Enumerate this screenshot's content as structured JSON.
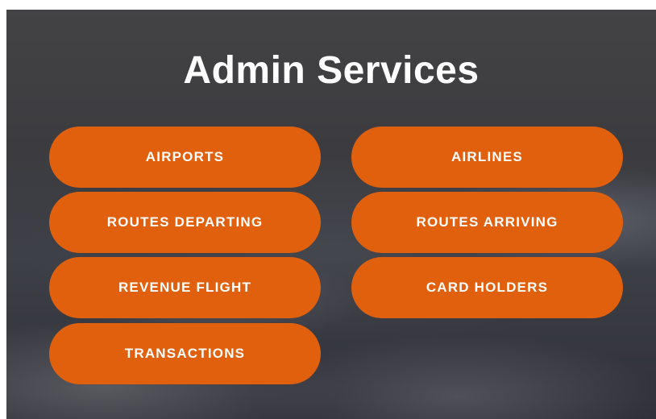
{
  "header": {
    "title": "Admin Services"
  },
  "buttons": {
    "airports": "AIRPORTS",
    "airlines": "AIRLINES",
    "routes_departing": "ROUTES DEPARTING",
    "routes_arriving": "ROUTES ARRIVING",
    "revenue_flight": "REVENUE FLIGHT",
    "card_holders": "CARD HOLDERS",
    "transactions": "TRANSACTIONS"
  },
  "colors": {
    "button_bg": "#e0600e",
    "button_text": "#ffffff",
    "title_text": "#ffffff",
    "background": "#3e3f44"
  }
}
